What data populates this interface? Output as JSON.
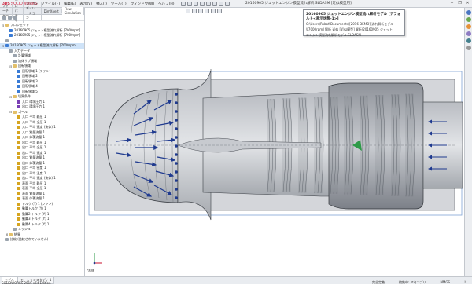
{
  "app": {
    "brand_ds": "3DS",
    "brand_sw": "SOLIDWORKS",
    "window_title": "20160905 ジェットエンジン模型流れ解析.SLDASM [近似模型用]",
    "menus": [
      "ファイル(F)",
      "編集(E)",
      "表示(V)",
      "挿入(I)",
      "ツール(T)",
      "ウィンドウ(W)",
      "ヘルプ(H)"
    ],
    "window_controls": [
      "─",
      "❐",
      "✕"
    ]
  },
  "tooltip": {
    "title": "20160905 ジェットエンジン模型流れ解析モデル [デフォルト<表示状態-1>]",
    "lines": [
      "C:\\Users\\Robot\\Documents\\[2016 DEMO] 流れ解析モデル",
      "\\[7000rpm] 解析 近似 [近似模型] 解析\\20160905 ジェット",
      "エンジン模型流れ解析モデル.SLDASM"
    ]
  },
  "left_panel": {
    "tabs": [
      "フィーチャー",
      "プロパティ",
      "コンフィギュレーション",
      "DimXpert",
      "Flow Simulation"
    ],
    "tree_rows": [
      {
        "exp": "⊟",
        "icon": "ic-fold",
        "label": "プロジェクト",
        "indent": 0
      },
      {
        "exp": "",
        "icon": "ic-flow",
        "label": "20160905 ジェット模型流れ解析 [7000rpm]",
        "indent": 1
      },
      {
        "exp": "",
        "icon": "ic-flow",
        "label": "20160905 ジェット模型流れ解析 [7000rpm]",
        "indent": 1
      },
      {
        "exp": "",
        "icon": "ic-gray",
        "label": "",
        "indent": 0
      },
      {
        "exp": "⊟",
        "icon": "ic-flow",
        "label": "20160905 ジェット模型流れ解析 [7000rpm]",
        "indent": 0,
        "selected": true
      },
      {
        "exp": "",
        "icon": "ic-gray",
        "label": "入力データ",
        "indent": 1
      },
      {
        "exp": "",
        "icon": "ic-gray",
        "label": "計算領域",
        "indent": 2
      },
      {
        "exp": "",
        "icon": "ic-gray",
        "label": "流体サブ領域",
        "indent": 2
      },
      {
        "exp": "⊟",
        "icon": "ic-fold",
        "label": "回転領域",
        "indent": 2
      },
      {
        "exp": "",
        "icon": "ic-flow",
        "label": "回転領域 1 (ファン)",
        "indent": 3
      },
      {
        "exp": "",
        "icon": "ic-flow",
        "label": "回転領域 2",
        "indent": 3
      },
      {
        "exp": "",
        "icon": "ic-flow",
        "label": "回転領域 3",
        "indent": 3
      },
      {
        "exp": "",
        "icon": "ic-flow",
        "label": "回転領域 4",
        "indent": 3
      },
      {
        "exp": "",
        "icon": "ic-flow",
        "label": "回転領域 5",
        "indent": 3
      },
      {
        "exp": "⊟",
        "icon": "ic-fold",
        "label": "境界条件",
        "indent": 2
      },
      {
        "exp": "",
        "icon": "ic-bc",
        "label": "入口 環境圧力 1",
        "indent": 3
      },
      {
        "exp": "",
        "icon": "ic-bc",
        "label": "出口 環境圧力 1",
        "indent": 3
      },
      {
        "exp": "⊟",
        "icon": "ic-fold",
        "label": "ゴール",
        "indent": 2
      },
      {
        "exp": "",
        "icon": "ic-goal",
        "label": "入口 平均 静圧 1",
        "indent": 3
      },
      {
        "exp": "",
        "icon": "ic-goal",
        "label": "入口 平均 全圧 1",
        "indent": 3
      },
      {
        "exp": "",
        "icon": "ic-goal",
        "label": "入口 平均 速度 (流体) 1",
        "indent": 3
      },
      {
        "exp": "",
        "icon": "ic-goal",
        "label": "入口 質量流量 1",
        "indent": 3
      },
      {
        "exp": "",
        "icon": "ic-goal",
        "label": "入口 体積流量 1",
        "indent": 3
      },
      {
        "exp": "",
        "icon": "ic-goal",
        "label": "出口 平均 静圧 1",
        "indent": 3
      },
      {
        "exp": "",
        "icon": "ic-goal",
        "label": "出口 平均 全圧 1",
        "indent": 3
      },
      {
        "exp": "",
        "icon": "ic-goal",
        "label": "出口 平均 速度 1",
        "indent": 3
      },
      {
        "exp": "",
        "icon": "ic-goal",
        "label": "出口 質量流量 1",
        "indent": 3
      },
      {
        "exp": "",
        "icon": "ic-goal",
        "label": "出口 体積流量 1",
        "indent": 3
      },
      {
        "exp": "",
        "icon": "ic-goal",
        "label": "出口 平均 密度 1",
        "indent": 3
      },
      {
        "exp": "",
        "icon": "ic-goal",
        "label": "出口 平均 温度 1",
        "indent": 3
      },
      {
        "exp": "",
        "icon": "ic-goal",
        "label": "出口 平均 速度 (流体) 1",
        "indent": 3
      },
      {
        "exp": "",
        "icon": "ic-goal",
        "label": "表面 平均 静圧 1",
        "indent": 3
      },
      {
        "exp": "",
        "icon": "ic-goal",
        "label": "表面 平均 全圧 1",
        "indent": 3
      },
      {
        "exp": "",
        "icon": "ic-goal",
        "label": "表面 質量流量 1",
        "indent": 3
      },
      {
        "exp": "",
        "icon": "ic-goal",
        "label": "表面 体積流量 1",
        "indent": 3
      },
      {
        "exp": "",
        "icon": "ic-goal",
        "label": "トルク (Y) 1 (ファン)",
        "indent": 3
      },
      {
        "exp": "",
        "icon": "ic-goal",
        "label": "動翼トルク (Y) 1",
        "indent": 3
      },
      {
        "exp": "",
        "icon": "ic-goal",
        "label": "動翼2 トルク (Y) 1",
        "indent": 3
      },
      {
        "exp": "",
        "icon": "ic-goal",
        "label": "動翼3 トルク (Y) 1",
        "indent": 3
      },
      {
        "exp": "",
        "icon": "ic-goal",
        "label": "動翼4 トルク (Y) 1",
        "indent": 3
      },
      {
        "exp": "",
        "icon": "ic-gray",
        "label": "メッシュ",
        "indent": 2
      },
      {
        "exp": "⊞",
        "icon": "ic-fold",
        "label": "結果",
        "indent": 1
      },
      {
        "exp": "",
        "icon": "ic-gray",
        "label": "比較 (比較されていません)",
        "indent": 0
      }
    ]
  },
  "bottom": {
    "tabs": [
      "モデル",
      "モーションスタディ 1"
    ],
    "status_left": "SOLIDWORKS 2016 x64 Edition",
    "status_right": [
      "完全定義",
      "編集中: アセンブリ",
      "MMGS",
      "？"
    ]
  },
  "viewport": {
    "triad_label": "*右側",
    "accent_arrow_color": "#1f3a8f",
    "engine_color": "#8f939a"
  }
}
